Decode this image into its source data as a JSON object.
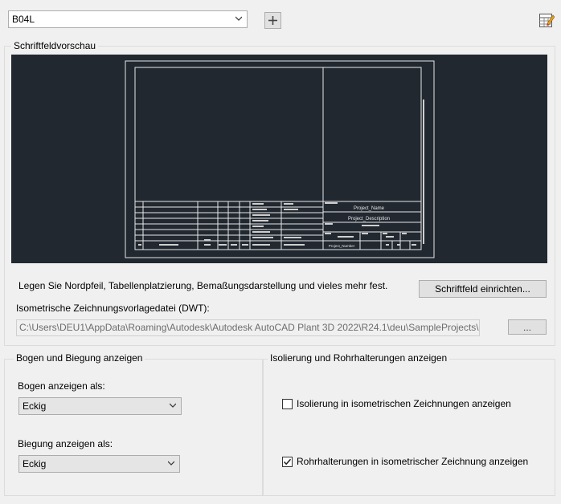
{
  "top": {
    "template_value": "B04L",
    "add_tooltip": "+"
  },
  "preview": {
    "group_title": "Schriftfeldvorschau",
    "titleblock": {
      "project_name": "Project_Name",
      "project_description": "Project_Description",
      "project_number": "Project_Number"
    },
    "info_text": "Legen Sie Nordpfeil, Tabellenplatzierung, Bemaßungsdarstellung und vieles mehr fest.",
    "setup_button": "Schriftfeld einrichten...",
    "dwt_label": "Isometrische Zeichnungsvorlagedatei (DWT):",
    "dwt_path": "C:\\Users\\DEU1\\AppData\\Roaming\\Autodesk\\Autodesk AutoCAD Plant 3D 2022\\R24.1\\deu\\SampleProjects\\SamplePr",
    "browse_button": "..."
  },
  "bends": {
    "group_title": "Bogen und Biegung anzeigen",
    "bogen_label": "Bogen anzeigen als:",
    "bogen_value": "Eckig",
    "biegung_label": "Biegung anzeigen als:",
    "biegung_value": "Eckig"
  },
  "insulation": {
    "group_title": "Isolierung und Rohrhalterungen anzeigen",
    "iso_label": "Isolierung in isometrischen Zeichnungen anzeigen",
    "iso_checked": false,
    "support_label": "Rohrhalterungen in isometrischer Zeichnung anzeigen",
    "support_checked": true
  }
}
